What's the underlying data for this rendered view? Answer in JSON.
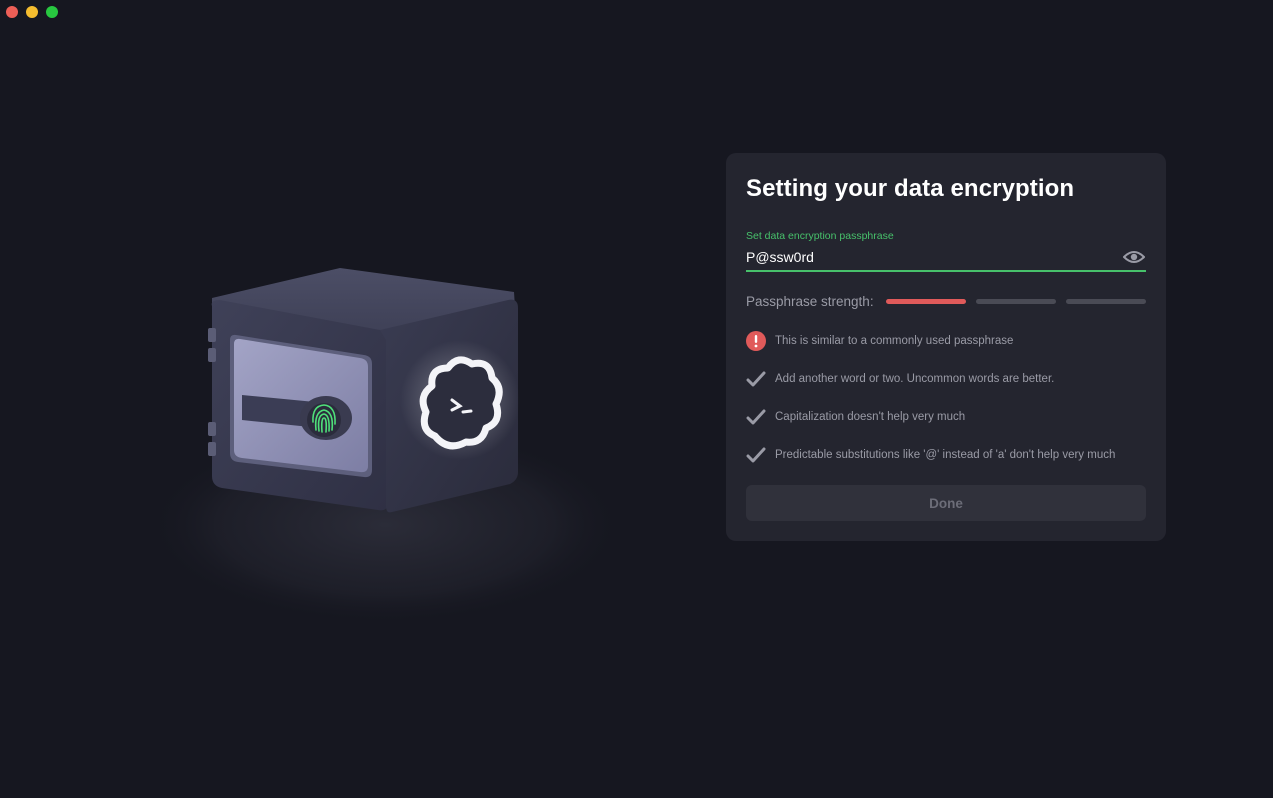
{
  "window": {
    "controls": [
      "close",
      "minimize",
      "maximize"
    ]
  },
  "illustration": {
    "icon": "safe-with-fingerprint-and-cloud-icon"
  },
  "card": {
    "title": "Setting your data encryption",
    "field": {
      "label": "Set data encryption passphrase",
      "value": "P@ssw0rd",
      "icon": "eye-icon"
    },
    "strength": {
      "label": "Passphrase strength:",
      "level": 1,
      "levels": 3,
      "active_color": "#e05a5a"
    },
    "tips": [
      {
        "icon": "warning-icon",
        "text": "This is similar to a commonly used passphrase"
      },
      {
        "icon": "check-icon",
        "text": "Add another word or two. Uncommon words are better."
      },
      {
        "icon": "check-icon",
        "text": "Capitalization doesn't help very much"
      },
      {
        "icon": "check-icon",
        "text": "Predictable substitutions like '@' instead of 'a' don't help very much"
      }
    ],
    "done_label": "Done"
  },
  "colors": {
    "accent_green": "#47c16b",
    "warning_red": "#e05a5a"
  }
}
